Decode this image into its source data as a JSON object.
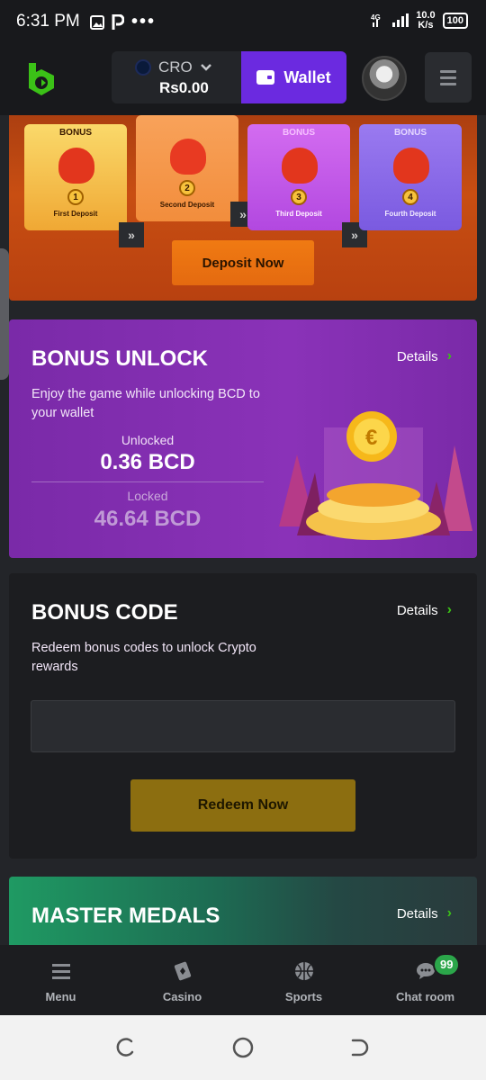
{
  "status_bar": {
    "time": "6:31 PM",
    "network": "4G",
    "speed_value": "10.0",
    "speed_unit": "K/s",
    "battery": "100"
  },
  "header": {
    "currency": "CRO",
    "balance": "Rs0.00",
    "wallet_label": "Wallet"
  },
  "deposit_bonus": {
    "tiles": [
      {
        "bonus": "BONUS",
        "number": "1",
        "label": "First Deposit"
      },
      {
        "bonus": "BONUS",
        "number": "2",
        "label": "Second Deposit"
      },
      {
        "bonus": "BONUS",
        "number": "3",
        "label": "Third Deposit"
      },
      {
        "bonus": "BONUS",
        "number": "4",
        "label": "Fourth Deposit"
      }
    ],
    "arrows": "»",
    "button_label": "Deposit Now"
  },
  "bonus_unlock": {
    "title": "BONUS UNLOCK",
    "details_label": "Details",
    "description": "Enjoy the game while unlocking BCD to your wallet",
    "unlocked_label": "Unlocked",
    "unlocked_value": "0.36 BCD",
    "locked_label": "Locked",
    "locked_value": "46.64 BCD"
  },
  "bonus_code": {
    "title": "BONUS CODE",
    "details_label": "Details",
    "description": "Redeem bonus codes to unlock Crypto rewards",
    "input_value": "",
    "button_label": "Redeem Now"
  },
  "master_medals": {
    "title": "MASTER MEDALS",
    "details_label": "Details"
  },
  "tabbar": {
    "items": [
      {
        "label": "Menu",
        "icon": "menu-icon"
      },
      {
        "label": "Casino",
        "icon": "casino-icon"
      },
      {
        "label": "Sports",
        "icon": "sports-icon"
      },
      {
        "label": "Chat room",
        "icon": "chat-icon"
      }
    ],
    "chat_badge": "99"
  },
  "colors": {
    "accent_purple": "#6b2ae0",
    "accent_green": "#3bc117",
    "deposit_orange": "#e46a10",
    "redeem_gold": "#8c6e10"
  }
}
